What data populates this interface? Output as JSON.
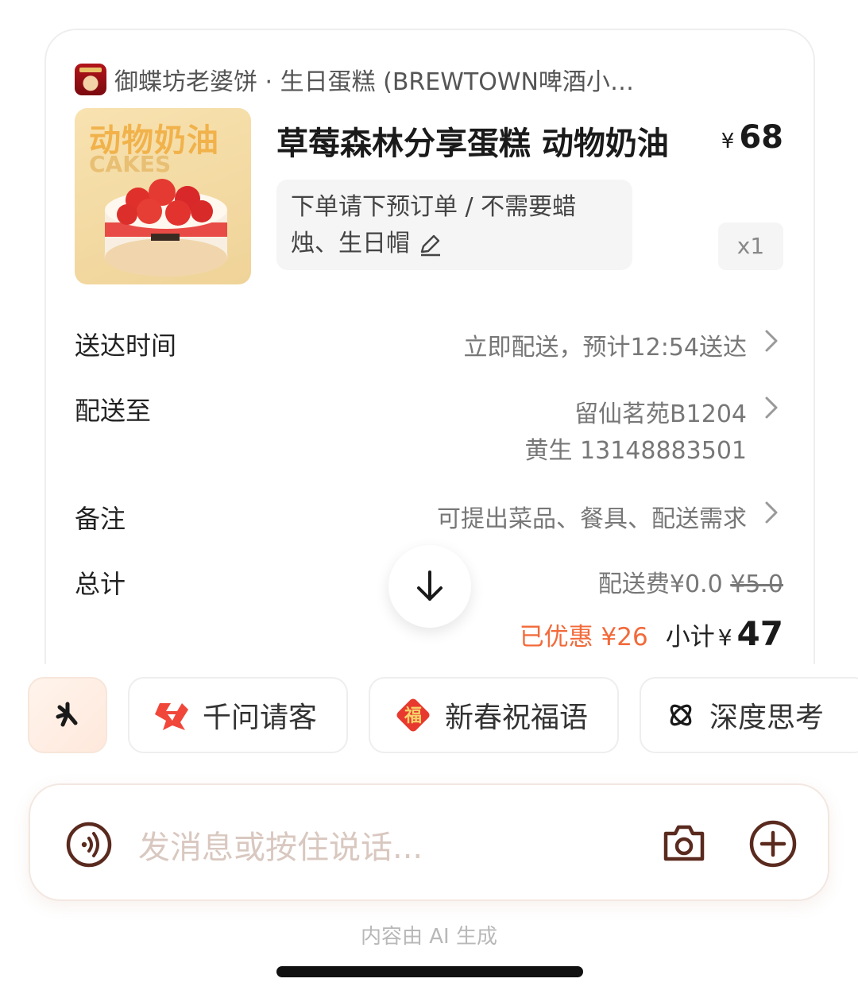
{
  "store": {
    "name": "御蝶坊老婆饼 · 生日蛋糕 (BREWTOWN啤酒小镇店)",
    "logo_icon": "store-logo-icon"
  },
  "product": {
    "title": "草莓森林分享蛋糕 动物奶油",
    "price_symbol": "¥",
    "price": "68",
    "image_text": "动物奶油",
    "image_text_2": "CAKES",
    "note": "下单请下预订单 / 不需要蜡烛、生日帽",
    "quantity": "x1"
  },
  "delivery_time": {
    "label": "送达时间",
    "value": "立即配送，预计12:54送达"
  },
  "address": {
    "label": "配送至",
    "line1": "留仙茗苑B1204",
    "line2": "黄生 13148883501"
  },
  "remark": {
    "label": "备注",
    "placeholder": "可提出菜品、餐具、配送需求"
  },
  "total": {
    "label": "总计",
    "fee_label": "配送费",
    "fee": "¥0.0",
    "fee_original": "¥5.0",
    "discount": "已优惠 ¥26",
    "subtotal_label": "小计",
    "subtotal_symbol": "¥",
    "subtotal": "47"
  },
  "chips": [
    {
      "label": "千问请客",
      "icon": "qianwen-icon"
    },
    {
      "label": "新春祝福语",
      "icon": "fu-icon"
    },
    {
      "label": "深度思考",
      "icon": "deep-think-icon"
    }
  ],
  "input": {
    "placeholder": "发消息或按住说话..."
  },
  "footer_note": "内容由 AI 生成",
  "colors": {
    "accent": "#f26a3a",
    "icon_brown": "#5a2a1e",
    "price_text": "#1a1a1a"
  }
}
